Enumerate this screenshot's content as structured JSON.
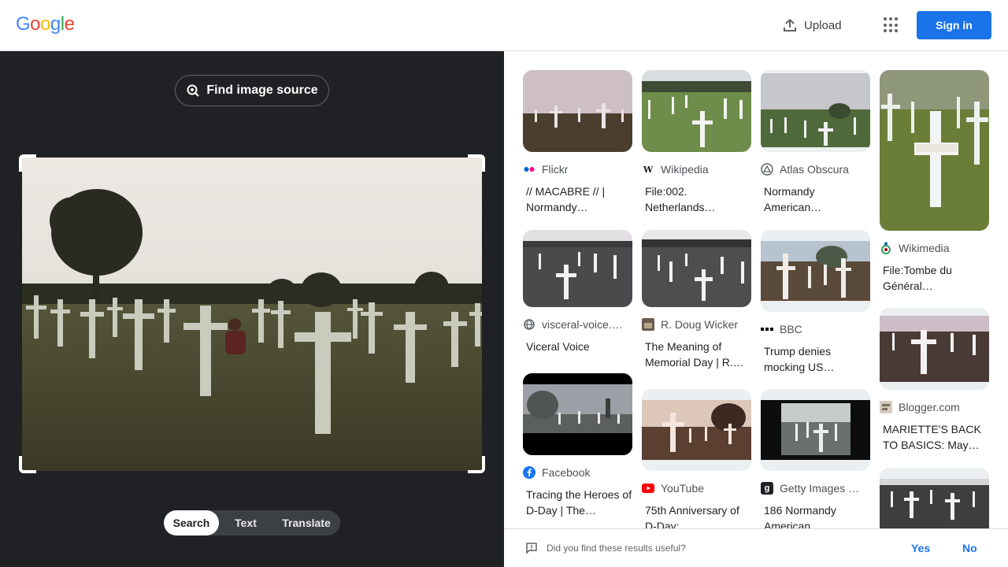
{
  "header": {
    "logo": "Google",
    "upload_label": "Upload",
    "signin_label": "Sign in"
  },
  "left": {
    "find_source_label": "Find image source",
    "modes": [
      "Search",
      "Text",
      "Translate"
    ],
    "active_mode": "Search"
  },
  "results": [
    {
      "source": "Flickr",
      "title": "// MACABRE // | Normandy…",
      "favicon": "flickr-icon"
    },
    {
      "source": "Wikipedia",
      "title": "File:002. Netherlands…",
      "favicon": "wikipedia-icon"
    },
    {
      "source": "Atlas Obscura",
      "title": "Normandy American…",
      "favicon": "atlas-obscura-icon"
    },
    {
      "source": "Wikimedia",
      "title": "File:Tombe du Général…",
      "favicon": "wikimedia-icon"
    },
    {
      "source": "visceral-voice.…",
      "title": "Viceral Voice",
      "favicon": "globe-icon"
    },
    {
      "source": "R. Doug Wicker",
      "title": "The Meaning of Memorial Day | R.…",
      "favicon": "site-icon"
    },
    {
      "source": "BBC",
      "title": "Trump denies mocking US…",
      "favicon": "bbc-icon"
    },
    {
      "source": "Blogger.com",
      "title": "MARIETTE'S BACK TO BASICS: May…",
      "favicon": "blogger-icon"
    },
    {
      "source": "Facebook",
      "title": "Tracing the Heroes of D-Day | The…",
      "favicon": "facebook-icon"
    },
    {
      "source": "YouTube",
      "title": "75th Anniversary of D-Day:…",
      "favicon": "youtube-icon"
    },
    {
      "source": "Getty Images …",
      "title": "186 Normandy American…",
      "favicon": "getty-icon"
    }
  ],
  "feedback": {
    "question": "Did you find these results useful?",
    "yes": "Yes",
    "no": "No"
  },
  "colors": {
    "accent": "#1a73e8",
    "left_bg": "#202124"
  }
}
